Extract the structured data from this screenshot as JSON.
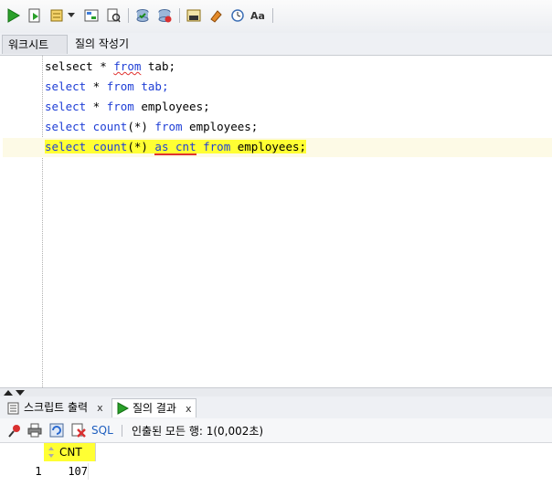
{
  "worksheet_tabs": {
    "worksheet": "워크시트",
    "query_builder": "질의 작성기"
  },
  "code": {
    "line1": {
      "a": "selsect * ",
      "from": "from",
      "b": " tab;"
    },
    "line2": {
      "select": "select",
      "a": " * ",
      "from": "from",
      "b": " tab;"
    },
    "line3": {
      "select": "select",
      "a": " * ",
      "from": "from",
      "b": " employees;"
    },
    "line4": {
      "select": "select",
      "count": " count",
      "a": "(*) ",
      "from": "from",
      "b": " employees;"
    },
    "line5": {
      "select": "select",
      "count": " count",
      "a": "(*) ",
      "as": "as",
      "sp": " ",
      "cnt": "cnt",
      "from": " from",
      "b": " employees;"
    }
  },
  "bottom_tabs": {
    "script_output": "스크립트 출력",
    "query_result": "질의 결과",
    "close": "x"
  },
  "result_toolbar": {
    "sql_label": "SQL",
    "status": "인출된 모든 행: 1(0,002초)"
  },
  "grid": {
    "column": "CNT",
    "rows": [
      {
        "num": "1",
        "cnt": "107"
      }
    ]
  },
  "icons": [
    "run-icon",
    "run-script-icon",
    "autotrace-icon",
    "explain-plan-icon",
    "sql-tuning-icon",
    "commit-icon",
    "rollback-icon",
    "sql-format-icon",
    "eraser-icon",
    "history-icon",
    "case-icon"
  ],
  "colors": {
    "keyword": "#1f3fd6",
    "highlight": "#ffff33",
    "error_underline": "#e0322f"
  }
}
